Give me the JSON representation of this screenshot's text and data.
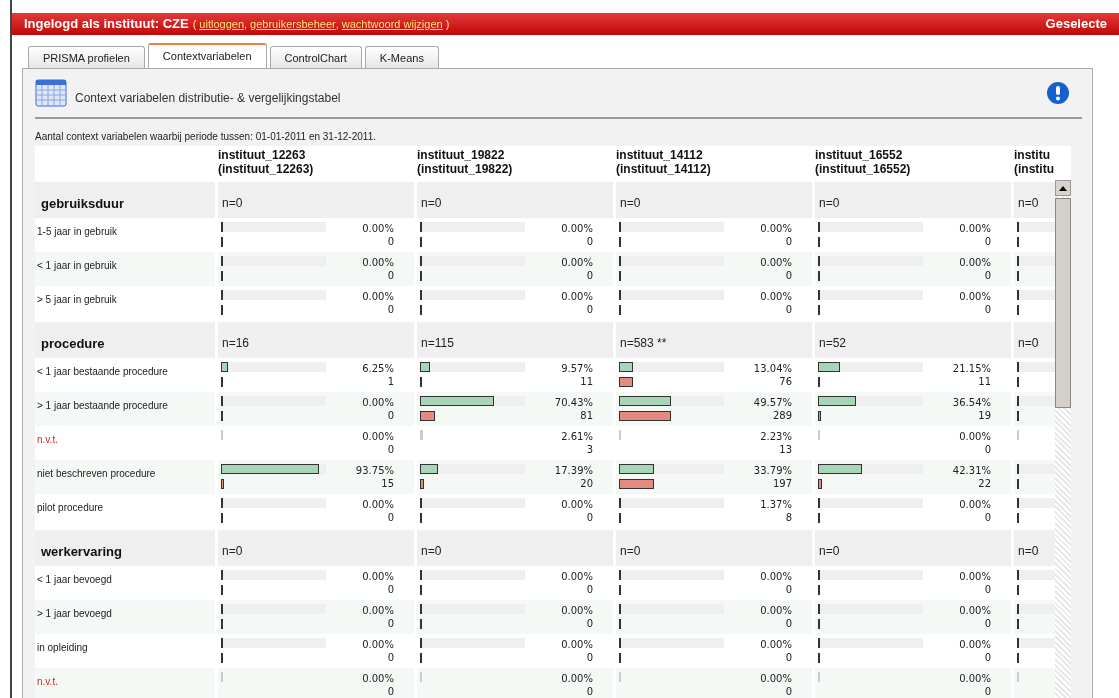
{
  "header": {
    "login_label": "Ingelogd als instituut: CZE",
    "open": "(",
    "separator": ",",
    "close": ")",
    "links": [
      "uitloggen",
      "gebruikersbeheer",
      "wachtwoord wijzigen"
    ],
    "right_text": "Geselecte"
  },
  "tabs": [
    {
      "label": "PRISMA profielen",
      "selected": false
    },
    {
      "label": "Contextvariabelen",
      "selected": true
    },
    {
      "label": "ControlChart",
      "selected": false
    },
    {
      "label": "K-Means",
      "selected": false
    }
  ],
  "panel": {
    "title": "Context variabelen distributie- & vergelijkingstabel",
    "caption": "Aantal context variabelen waarbij periode tussen: 01-01-2011 en 31-12-2011."
  },
  "table": {
    "columns": [
      {
        "name": "instituut_12263",
        "sub": "(instituut_12263)"
      },
      {
        "name": "instituut_19822",
        "sub": "(instituut_19822)"
      },
      {
        "name": "instituut_14112",
        "sub": "(instituut_14112)"
      },
      {
        "name": "instituut_16552",
        "sub": "(instituut_16552)"
      },
      {
        "name": "institu",
        "sub": "(institu"
      }
    ],
    "groups": [
      {
        "name": "gebruiksduur",
        "counts": [
          "n=0",
          "n=0",
          "n=0",
          "n=0",
          "n=0"
        ],
        "rows": [
          {
            "label": "1-5 jaar in gebruik",
            "kind": "normal",
            "cells": [
              {
                "pct": "0.00%",
                "count": "0",
                "bars": [
                  {
                    "level": 0
                  },
                  {
                    "level": 0
                  }
                ]
              },
              {
                "pct": "0.00%",
                "count": "0",
                "bars": [
                  {
                    "level": 0
                  },
                  {
                    "level": 0
                  }
                ]
              },
              {
                "pct": "0.00%",
                "count": "0",
                "bars": [
                  {
                    "level": 0
                  },
                  {
                    "level": 0
                  }
                ]
              },
              {
                "pct": "0.00%",
                "count": "0",
                "bars": [
                  {
                    "level": 0
                  },
                  {
                    "level": 0
                  }
                ]
              },
              {
                "bars": [
                  {
                    "level": 0
                  },
                  {
                    "level": 0
                  }
                ]
              }
            ]
          },
          {
            "label": "< 1 jaar in gebruik",
            "kind": "normal",
            "cells": [
              {
                "pct": "0.00%",
                "count": "0",
                "bars": [
                  {
                    "level": 0
                  },
                  {
                    "level": 0
                  }
                ]
              },
              {
                "pct": "0.00%",
                "count": "0",
                "bars": [
                  {
                    "level": 0
                  },
                  {
                    "level": 0
                  }
                ]
              },
              {
                "pct": "0.00%",
                "count": "0",
                "bars": [
                  {
                    "level": 0
                  },
                  {
                    "level": 0
                  }
                ]
              },
              {
                "pct": "0.00%",
                "count": "0",
                "bars": [
                  {
                    "level": 0
                  },
                  {
                    "level": 0
                  }
                ]
              },
              {
                "bars": [
                  {
                    "level": 0
                  },
                  {
                    "level": 0
                  }
                ]
              }
            ]
          },
          {
            "label": "> 5 jaar in gebruik",
            "kind": "normal",
            "cells": [
              {
                "pct": "0.00%",
                "count": "0",
                "bars": [
                  {
                    "level": 0
                  },
                  {
                    "level": 0
                  }
                ]
              },
              {
                "pct": "0.00%",
                "count": "0",
                "bars": [
                  {
                    "level": 0
                  },
                  {
                    "level": 0
                  }
                ]
              },
              {
                "pct": "0.00%",
                "count": "0",
                "bars": [
                  {
                    "level": 0
                  },
                  {
                    "level": 0
                  }
                ]
              },
              {
                "pct": "0.00%",
                "count": "0",
                "bars": [
                  {
                    "level": 0
                  },
                  {
                    "level": 0
                  }
                ]
              },
              {
                "bars": [
                  {
                    "level": 0
                  },
                  {
                    "level": 0
                  }
                ]
              }
            ]
          }
        ]
      },
      {
        "name": "procedure",
        "counts": [
          "n=16",
          "n=115",
          "n=583 **",
          "n=52",
          "n=0"
        ],
        "rows": [
          {
            "label": "< 1 jaar bestaande procedure",
            "kind": "normal",
            "cells": [
              {
                "pct": "6.25%",
                "count": "1",
                "bars": [
                  {
                    "level": 0.0625
                  },
                  {
                    "level": 0.002
                  }
                ]
              },
              {
                "pct": "9.57%",
                "count": "11",
                "bars": [
                  {
                    "level": 0.0957
                  },
                  {
                    "level": 0.019
                  }
                ]
              },
              {
                "pct": "13.04%",
                "count": "76",
                "bars": [
                  {
                    "level": 0.1304
                  },
                  {
                    "level": 0.13
                  }
                ]
              },
              {
                "pct": "21.15%",
                "count": "11",
                "bars": [
                  {
                    "level": 0.2115
                  },
                  {
                    "level": 0.019
                  }
                ]
              },
              {
                "bars": [
                  {
                    "level": 0
                  },
                  {
                    "level": 0
                  }
                ]
              }
            ]
          },
          {
            "label": "> 1 jaar bestaande procedure",
            "kind": "normal",
            "cells": [
              {
                "pct": "0.00%",
                "count": "0",
                "bars": [
                  {
                    "level": 0
                  },
                  {
                    "level": 0
                  }
                ]
              },
              {
                "pct": "70.43%",
                "count": "81",
                "bars": [
                  {
                    "level": 0.7043
                  },
                  {
                    "level": 0.139
                  }
                ]
              },
              {
                "pct": "49.57%",
                "count": "289",
                "bars": [
                  {
                    "level": 0.4957
                  },
                  {
                    "level": 0.496
                  }
                ]
              },
              {
                "pct": "36.54%",
                "count": "19",
                "bars": [
                  {
                    "level": 0.3654
                  },
                  {
                    "level": 0.033
                  }
                ]
              },
              {
                "bars": [
                  {
                    "level": 0
                  },
                  {
                    "level": 0
                  }
                ]
              }
            ]
          },
          {
            "label": "n.v.t.",
            "kind": "excluded",
            "cells": [
              {
                "pct": "0.00%",
                "count": "0",
                "bars": [
                  {
                    "level": 0
                  }
                ]
              },
              {
                "pct": "2.61%",
                "count": "3",
                "bars": [
                  {
                    "level": 0.0261
                  }
                ]
              },
              {
                "pct": "2.23%",
                "count": "13",
                "bars": [
                  {
                    "level": 0.0223
                  }
                ]
              },
              {
                "pct": "0.00%",
                "count": "0",
                "bars": [
                  {
                    "level": 0
                  }
                ]
              },
              {
                "bars": [
                  {
                    "level": 0
                  }
                ]
              }
            ]
          },
          {
            "label": "niet beschreven procedure",
            "kind": "normal",
            "cells": [
              {
                "pct": "93.75%",
                "count": "15",
                "bars": [
                  {
                    "level": 0.9375
                  },
                  {
                    "level": 0.026
                  }
                ]
              },
              {
                "pct": "17.39%",
                "count": "20",
                "bars": [
                  {
                    "level": 0.1739
                  },
                  {
                    "level": 0.034
                  }
                ]
              },
              {
                "pct": "33.79%",
                "count": "197",
                "bars": [
                  {
                    "level": 0.3379
                  },
                  {
                    "level": 0.338
                  }
                ]
              },
              {
                "pct": "42.31%",
                "count": "22",
                "bars": [
                  {
                    "level": 0.4231
                  },
                  {
                    "level": 0.038
                  }
                ]
              },
              {
                "bars": [
                  {
                    "level": 0
                  },
                  {
                    "level": 0
                  }
                ]
              }
            ]
          },
          {
            "label": "pilot procedure",
            "kind": "normal",
            "cells": [
              {
                "pct": "0.00%",
                "count": "0",
                "bars": [
                  {
                    "level": 0
                  },
                  {
                    "level": 0
                  }
                ]
              },
              {
                "pct": "0.00%",
                "count": "0",
                "bars": [
                  {
                    "level": 0
                  },
                  {
                    "level": 0
                  }
                ]
              },
              {
                "pct": "1.37%",
                "count": "8",
                "bars": [
                  {
                    "level": 0.0137
                  },
                  {
                    "level": 0.014
                  }
                ]
              },
              {
                "pct": "0.00%",
                "count": "0",
                "bars": [
                  {
                    "level": 0
                  },
                  {
                    "level": 0
                  }
                ]
              },
              {
                "bars": [
                  {
                    "level": 0
                  },
                  {
                    "level": 0
                  }
                ]
              }
            ]
          }
        ]
      },
      {
        "name": "werkervaring",
        "counts": [
          "n=0",
          "n=0",
          "n=0",
          "n=0",
          "n=0"
        ],
        "rows": [
          {
            "label": "< 1 jaar bevoegd",
            "kind": "normal",
            "cells": [
              {
                "pct": "0.00%",
                "count": "0",
                "bars": [
                  {
                    "level": 0
                  },
                  {
                    "level": 0
                  }
                ]
              },
              {
                "pct": "0.00%",
                "count": "0",
                "bars": [
                  {
                    "level": 0
                  },
                  {
                    "level": 0
                  }
                ]
              },
              {
                "pct": "0.00%",
                "count": "0",
                "bars": [
                  {
                    "level": 0
                  },
                  {
                    "level": 0
                  }
                ]
              },
              {
                "pct": "0.00%",
                "count": "0",
                "bars": [
                  {
                    "level": 0
                  },
                  {
                    "level": 0
                  }
                ]
              },
              {
                "bars": [
                  {
                    "level": 0
                  },
                  {
                    "level": 0
                  }
                ]
              }
            ]
          },
          {
            "label": "> 1 jaar bevoegd",
            "kind": "normal",
            "cells": [
              {
                "pct": "0.00%",
                "count": "0",
                "bars": [
                  {
                    "level": 0
                  },
                  {
                    "level": 0
                  }
                ]
              },
              {
                "pct": "0.00%",
                "count": "0",
                "bars": [
                  {
                    "level": 0
                  },
                  {
                    "level": 0
                  }
                ]
              },
              {
                "pct": "0.00%",
                "count": "0",
                "bars": [
                  {
                    "level": 0
                  },
                  {
                    "level": 0
                  }
                ]
              },
              {
                "pct": "0.00%",
                "count": "0",
                "bars": [
                  {
                    "level": 0
                  },
                  {
                    "level": 0
                  }
                ]
              },
              {
                "bars": [
                  {
                    "level": 0
                  },
                  {
                    "level": 0
                  }
                ]
              }
            ]
          },
          {
            "label": "in opleiding",
            "kind": "normal",
            "cells": [
              {
                "pct": "0.00%",
                "count": "0",
                "bars": [
                  {
                    "level": 0
                  },
                  {
                    "level": 0
                  }
                ]
              },
              {
                "pct": "0.00%",
                "count": "0",
                "bars": [
                  {
                    "level": 0
                  },
                  {
                    "level": 0
                  }
                ]
              },
              {
                "pct": "0.00%",
                "count": "0",
                "bars": [
                  {
                    "level": 0
                  },
                  {
                    "level": 0
                  }
                ]
              },
              {
                "pct": "0.00%",
                "count": "0",
                "bars": [
                  {
                    "level": 0
                  },
                  {
                    "level": 0
                  }
                ]
              },
              {
                "bars": [
                  {
                    "level": 0
                  },
                  {
                    "level": 0
                  }
                ]
              }
            ]
          },
          {
            "label": "n.v.t.",
            "kind": "excluded",
            "cells": [
              {
                "pct": "0.00%",
                "count": "0",
                "bars": [
                  {
                    "level": 0
                  }
                ]
              },
              {
                "pct": "0.00%",
                "count": "0",
                "bars": [
                  {
                    "level": 0
                  }
                ]
              },
              {
                "pct": "0.00%",
                "count": "0",
                "bars": [
                  {
                    "level": 0
                  }
                ]
              },
              {
                "pct": "0.00%",
                "count": "0",
                "bars": [
                  {
                    "level": 0
                  }
                ]
              },
              {
                "bars": [
                  {
                    "level": 0
                  }
                ]
              }
            ]
          }
        ]
      }
    ]
  }
}
